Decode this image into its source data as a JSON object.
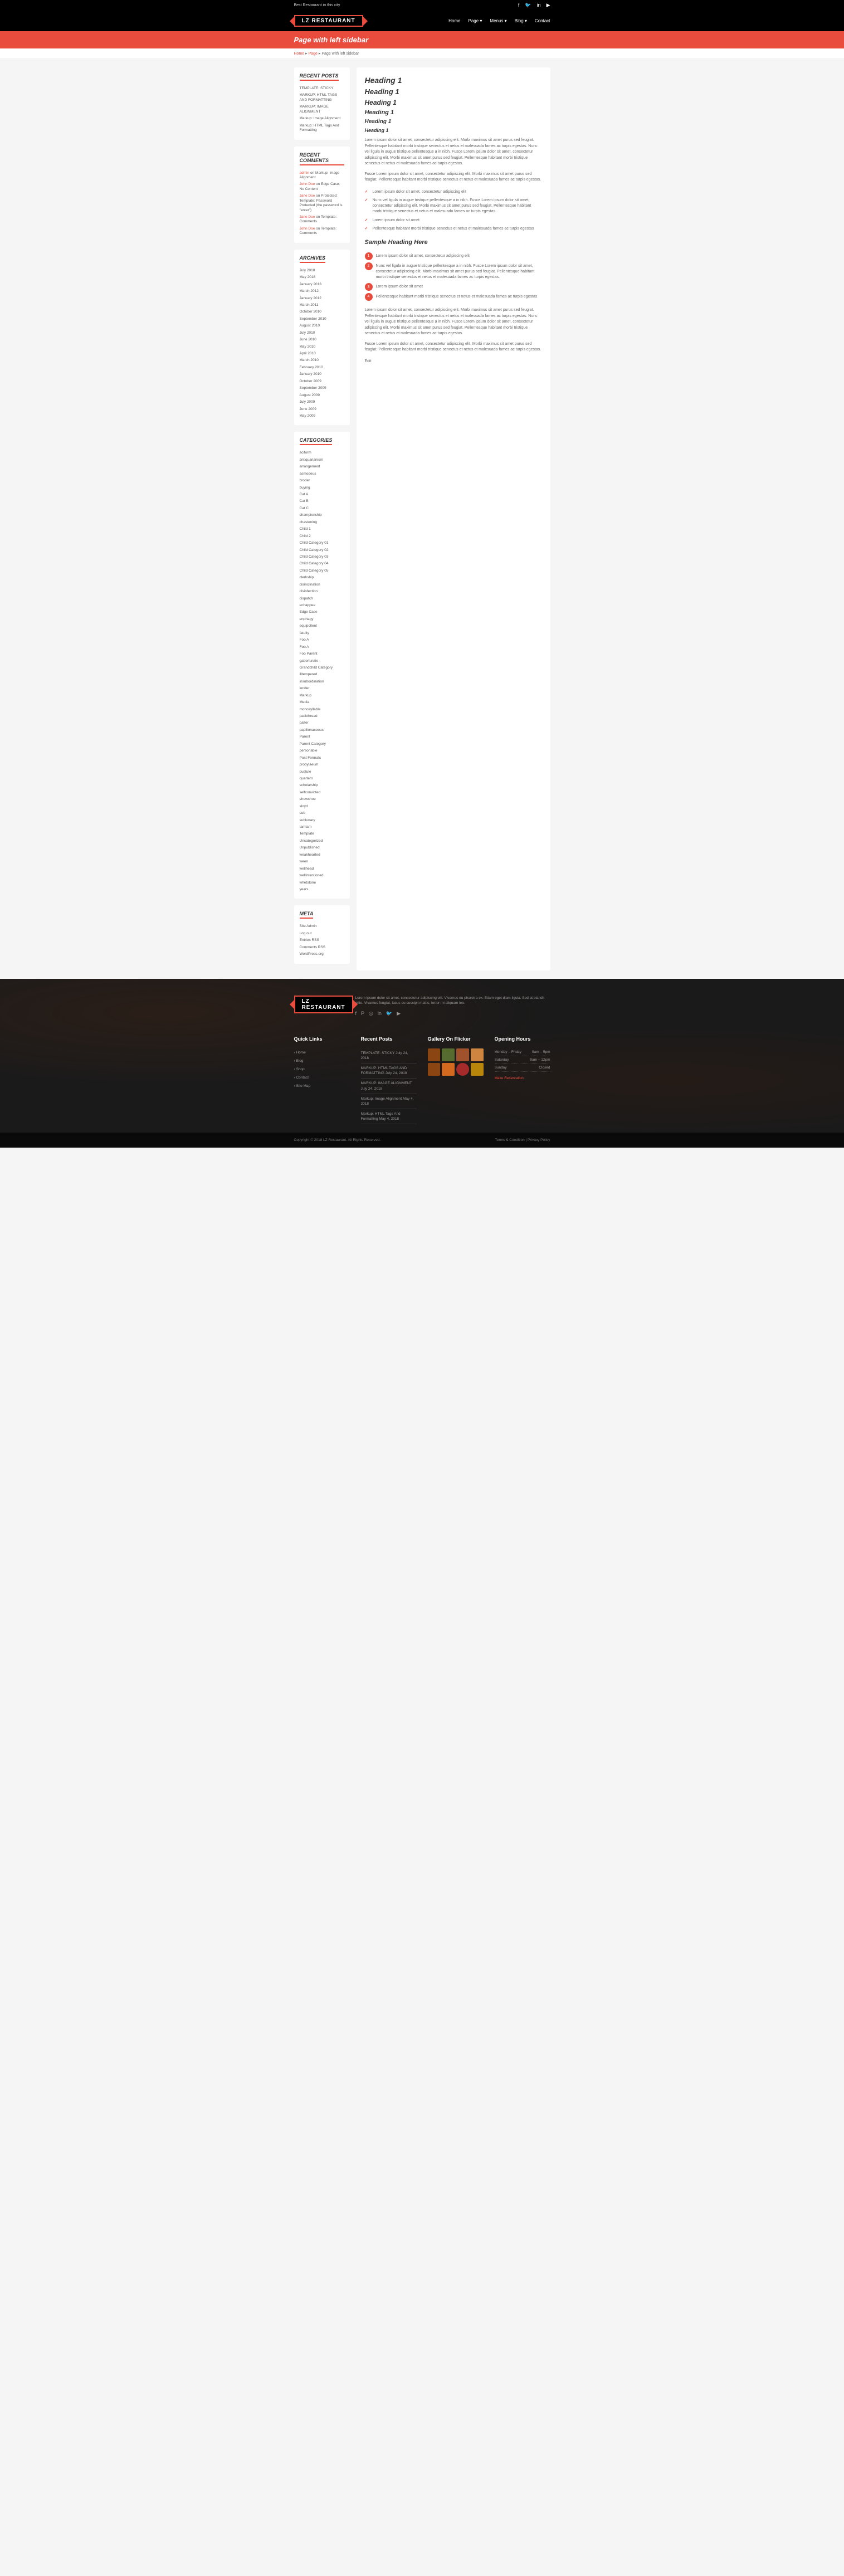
{
  "topbar": {
    "tagline": "Best Restaurant in this city"
  },
  "logo": {
    "text": "LZ RESTAURANT"
  },
  "nav": [
    {
      "label": "Home"
    },
    {
      "label": "Page ▾"
    },
    {
      "label": "Menus ▾"
    },
    {
      "label": "Blog ▾"
    },
    {
      "label": "Contact"
    }
  ],
  "pageTitle": "Page with left sidebar",
  "breadcrumb": {
    "home": "Home",
    "page": "Page",
    "current": "Page with left sidebar",
    "sep": " ▸ "
  },
  "widgets": {
    "recentPosts": {
      "title": "RECENT POSTS",
      "items": [
        "TEMPLATE: STICKY",
        "MARKUP: HTML TAGS AND FORMATTING",
        "MARKUP: IMAGE ALIGNMENT",
        "Markup: Image Alignment",
        "Markup: HTML Tags And Formatting"
      ]
    },
    "recentComments": {
      "title": "RECENT COMMENTS",
      "items": [
        {
          "author": "admin",
          "on": "on",
          "post": "Markup: Image Alignment"
        },
        {
          "author": "John Doe",
          "on": "on",
          "post": "Edge Case: No Content"
        },
        {
          "author": "Jane Doe",
          "on": "on",
          "post": "Protected: Template: Password Protected (the password is \"enter\")"
        },
        {
          "author": "Jane Doe",
          "on": "on",
          "post": "Template: Comments"
        },
        {
          "author": "John Doe",
          "on": "on",
          "post": "Template: Comments"
        }
      ]
    },
    "archives": {
      "title": "ARCHIVES",
      "items": [
        "July 2018",
        "May 2018",
        "January 2013",
        "March 2012",
        "January 2012",
        "March 2011",
        "October 2010",
        "September 2010",
        "August 2010",
        "July 2010",
        "June 2010",
        "May 2010",
        "April 2010",
        "March 2010",
        "February 2010",
        "January 2010",
        "October 2009",
        "September 2009",
        "August 2009",
        "July 2009",
        "June 2009",
        "May 2009"
      ]
    },
    "categories": {
      "title": "CATEGORIES",
      "items": [
        "aciform",
        "antiquarianism",
        "arrangement",
        "asmodeus",
        "broder",
        "buying",
        "Cat A",
        "Cat B",
        "Cat C",
        "championship",
        "chastening",
        "Child 1",
        "Child 2",
        "Child Category 01",
        "Child Category 02",
        "Child Category 03",
        "Child Category 04",
        "Child Category 05",
        "clerkship",
        "disinclination",
        "disinfection",
        "dispatch",
        "echappee",
        "Edge Case",
        "enphagy",
        "equipollent",
        "fatuity",
        "Foo A",
        "Foo A",
        "Foo Parent",
        "gaberlunzie",
        "Grandchild Category",
        "illtempered",
        "insubordination",
        "lender",
        "Markup",
        "Media",
        "monosyllable",
        "packthread",
        "palter",
        "papilionaceous",
        "Parent",
        "Parent Category",
        "personable",
        "Post Formats",
        "propylaeum",
        "pustule",
        "quartern",
        "scholarship",
        "selfconvicted",
        "showshoe",
        "sloyd",
        "sub",
        "sublunary",
        "tamtam",
        "Template",
        "Uncategorized",
        "Unpublished",
        "weakhearted",
        "ween",
        "wellhead",
        "wellintentioned",
        "whetstone",
        "years"
      ]
    },
    "meta": {
      "title": "META",
      "items": [
        "Site Admin",
        "Log out",
        "Entries RSS",
        "Comments RSS",
        "WordPress.org"
      ]
    }
  },
  "content": {
    "h1": "Heading 1",
    "h2": "Heading 1",
    "h3": "Heading 1",
    "h4": "Heading 1",
    "h5": "Heading 1",
    "h6": "Heading 1",
    "p1": "Lorem ipsum dolor sit amet, consectetur adipiscing elit. Morbi maximus sit amet purus sed feugiat. Pellentesque habitant morbi tristique senectus et netus et malesuada fames ac turpis egestas. Nunc vel ligula in augue tristique pellentesque a in nibh. Fusce Lorem ipsum dolor sit amet, consectetur adipiscing elit. Morbi maximus sit amet purus sed feugiat. Pellentesque habitant morbi tristique senectus et netus et malesuada fames ac turpis egestas.",
    "p2": "Fusce Lorem ipsum dolor sit amet, consectetur adipiscing elit. Morbi maximus sit amet purus sed feugiat. Pellentesque habitant morbi tristique senectus et netus et malesuada fames ac turpis egestas.",
    "checks": [
      "Lorem ipsum dolor sit amet, consectetur adipiscing elit",
      "Nunc vel ligula in augue tristique pellentesque a in nibh. Fusce Lorem ipsum dolor sit amet, consectetur adipiscing elit. Morbi maximus sit amet purus sed feugiat. Pellentesque habitant morbi tristique senectus et netus et malesuada fames ac turpis egestas.",
      "Lorem ipsum dolor sit amet",
      "Pellentesque habitant morbi tristique senectus et netus et malesuada fames ac turpis egestas"
    ],
    "sampleHeading": "Sample Heading Here",
    "nums": [
      "Lorem ipsum dolor sit amet, consectetur adipiscing elit",
      "Nunc vel ligula in augue tristique pellentesque a in nibh. Fusce Lorem ipsum dolor sit amet, consectetur adipiscing elit. Morbi maximus sit amet purus sed feugiat. Pellentesque habitant morbi tristique senectus et netus et malesuada fames ac turpis egestas.",
      "Lorem ipsum dolor sit amet",
      "Pellentesque habitant morbi tristique senectus et netus et malesuada fames ac turpis egestas"
    ],
    "p3": "Lorem ipsum dolor sit amet, consectetur adipiscing elit. Morbi maximus sit amet purus sed feugiat. Pellentesque habitant morbi tristique senectus et netus et malesuada fames ac turpis egestas. Nunc vel ligula in augue tristique pellentesque a in nibh. Fusce Lorem ipsum dolor sit amet, consectetur adipiscing elit. Morbi maximus sit amet purus sed feugiat. Pellentesque habitant morbi tristique senectus et netus et malesuada fames ac turpis egestas.",
    "p4": "Fusce Lorem ipsum dolor sit amet, consectetur adipiscing elit. Morbi maximus sit amet purus sed feugiat. Pellentesque habitant morbi tristique senectus et netus et malesuada fames ac turpis egestas.",
    "edit": "Edit"
  },
  "footer": {
    "desc": "Lorem ipsum dolor sit amet, consectetur adipiscing elit. Vivamus eu pharetra ex. Etiam eget diam ligula. Sed at blandit ante. Vivamus feugiat, lacus eu suscipit mattis, tortor mi aliquam leo.",
    "quickLinks": {
      "title": "Quick Links",
      "items": [
        "Home",
        "Blog",
        "Shop",
        "Contact",
        "Site Map"
      ]
    },
    "recentPosts": {
      "title": "Recent Posts",
      "items": [
        "TEMPLATE: STICKY July 24, 2018",
        "MARKUP: HTML TAGS AND FORMATTING July 24, 2018",
        "MARKUP: IMAGE ALIGNMENT July 24, 2018",
        "Markup: Image Alignment May 4, 2018",
        "Markup: HTML Tags And Formatting May 4, 2018"
      ]
    },
    "gallery": {
      "title": "Gallery On Flicker"
    },
    "hours": {
      "title": "Opening Hours",
      "rows": [
        {
          "day": "Monday – Friday",
          "time": "9am – 5pm"
        },
        {
          "day": "Saturday",
          "time": "9am – 12pm"
        },
        {
          "day": "Sunday",
          "time": "Closed"
        }
      ],
      "reservation": "Make Reservation"
    },
    "copyright": "Copyright © 2018 LZ Restaurant. All Rights Reserved.",
    "links": {
      "terms": "Terms & Condition",
      "privacy": "Privacy Policy",
      "sep": " | "
    }
  }
}
